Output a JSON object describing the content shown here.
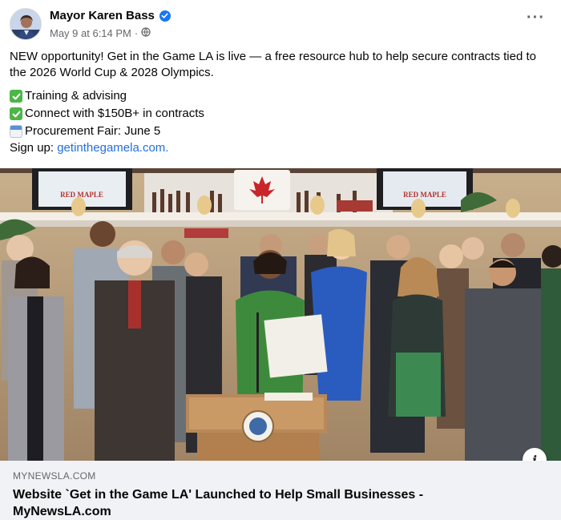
{
  "post": {
    "author": "Mayor Karen Bass",
    "timestamp": "May 9 at 6:14 PM",
    "separator": "·",
    "privacy_icon": "globe-icon",
    "verified_icon": "verified-badge-icon",
    "more_icon": "more-options-icon",
    "intro": "NEW opportunity! Get in the Game LA is live — a free resource hub to help secure contracts tied to the 2026 World Cup & 2028 Olympics.",
    "bullets": [
      {
        "icon": "check-mark-icon",
        "text": "Training & advising"
      },
      {
        "icon": "check-mark-icon",
        "text": "Connect with $150B+ in contracts"
      },
      {
        "icon": "calendar-icon",
        "text": "Procurement Fair: June 5"
      }
    ],
    "signup_label": "Sign up: ",
    "signup_link": "getinthegamela.com."
  },
  "photo": {
    "signage_left": "RED MAPLE",
    "signage_right": "RED MAPLE"
  },
  "link_preview": {
    "domain": "MYNEWSLA.COM",
    "title": "Website `Get in the Game LA' Launched to Help Small Businesses - MyNewsLA.com",
    "info_icon": "i"
  },
  "colors": {
    "link": "#216fdb",
    "verified": "#1877f2",
    "check": "#4cb648",
    "card_bg": "#f0f2f5"
  }
}
